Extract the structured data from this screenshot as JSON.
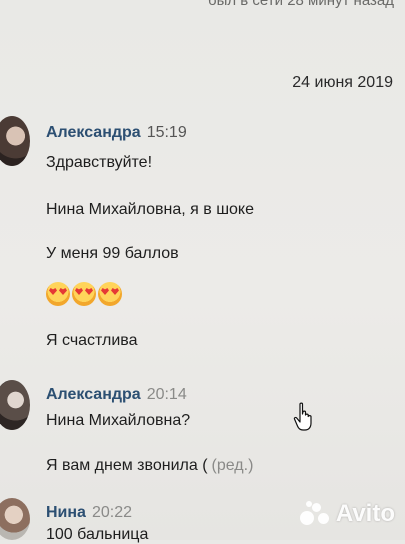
{
  "header": {
    "status": "был в сети 28 минут назад"
  },
  "date_separator": "24 июня 2019",
  "messages": [
    {
      "author": "Александра",
      "time": "15:19",
      "lines": [
        "Здравствуйте!",
        "Нина Михайловна, я в шоке",
        "У меня 99 баллов",
        "Я счастлива"
      ]
    },
    {
      "author": "Александра",
      "time": "20:14",
      "lines": [
        "Нина Михайловна?",
        "Я вам днем звонила ("
      ],
      "edited": "(ред.)"
    },
    {
      "author": "Нина",
      "time": "20:22",
      "lines": [
        "100 бальница"
      ]
    }
  ],
  "emoji": [
    "heart-eyes",
    "heart-eyes",
    "heart-eyes"
  ],
  "watermark": {
    "text": "Avito"
  }
}
